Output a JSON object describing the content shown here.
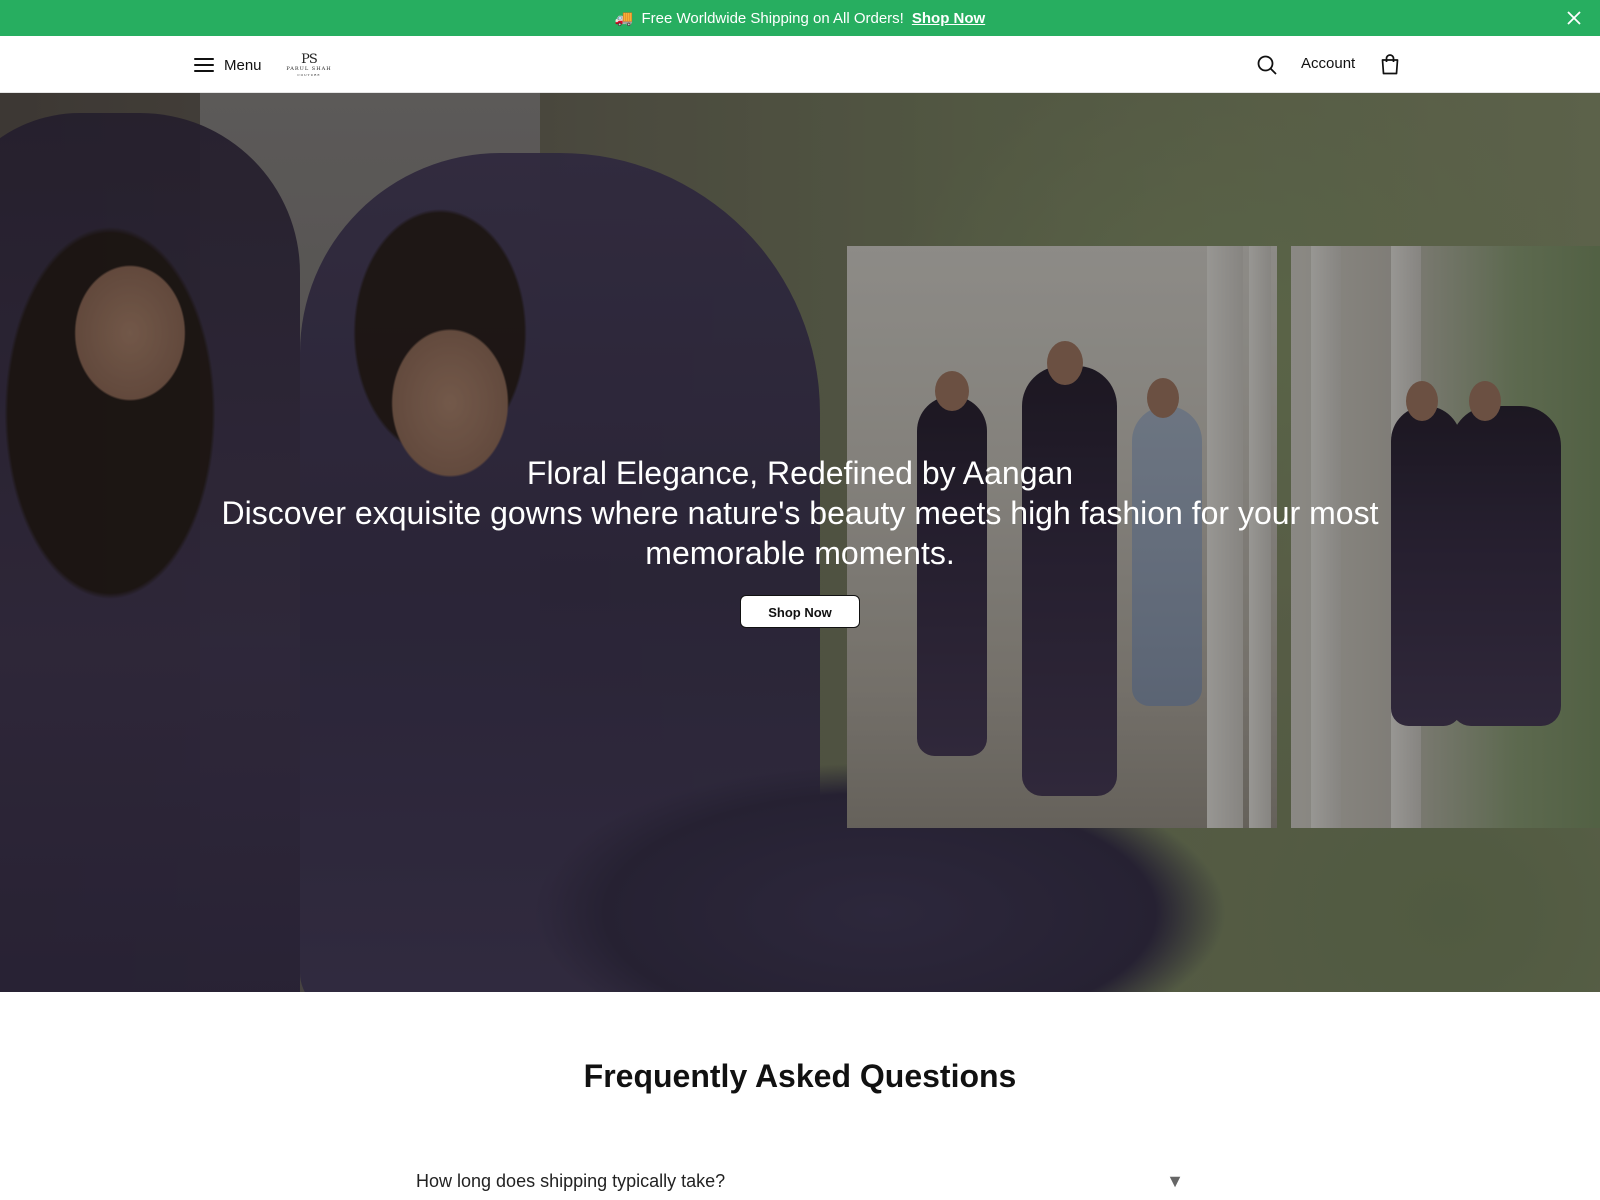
{
  "announcement": {
    "icon": "truck-icon",
    "text": "Free Worldwide Shipping on All Orders!",
    "link": "Shop Now",
    "background": "#27ae60"
  },
  "header": {
    "menu_label": "Menu",
    "logo": {
      "monogram": "PS",
      "brand": "PARUL SHAH",
      "sub": "COUTURE"
    },
    "account_label": "Account"
  },
  "hero": {
    "title": "Floral Elegance, Redefined by Aangan",
    "subtitle": "Discover exquisite gowns where nature's beauty meets high fashion for your most memorable moments.",
    "cta": "Shop Now"
  },
  "faq": {
    "title": "Frequently Asked Questions",
    "items": [
      {
        "question": "How long does shipping typically take?",
        "toggle": "▼"
      }
    ]
  }
}
